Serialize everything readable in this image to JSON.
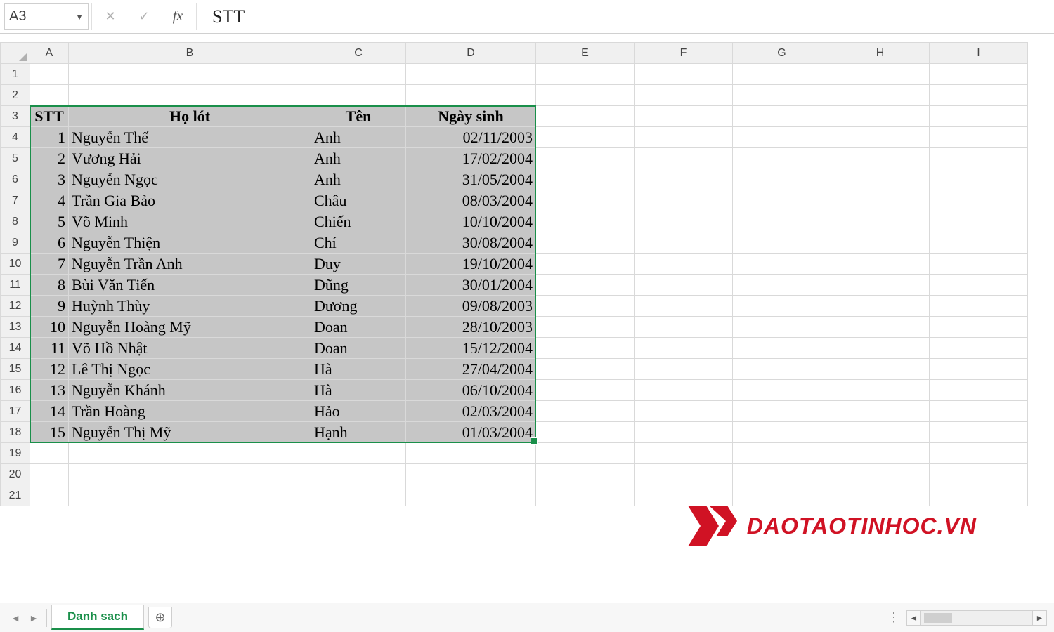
{
  "formula_bar": {
    "cell_ref": "A3",
    "fx_label": "fx",
    "value": "STT"
  },
  "columns": [
    "A",
    "B",
    "C",
    "D",
    "E",
    "F",
    "G",
    "H",
    "I"
  ],
  "row_numbers": [
    1,
    2,
    3,
    4,
    5,
    6,
    7,
    8,
    9,
    10,
    11,
    12,
    13,
    14,
    15,
    16,
    17,
    18,
    19,
    20,
    21
  ],
  "headers": {
    "stt": "STT",
    "ho_lot": "Họ lót",
    "ten": "Tên",
    "ngay_sinh": "Ngày sinh"
  },
  "data": [
    {
      "stt": 1,
      "ho": "Nguyễn Thế",
      "ten": "Anh",
      "dob": "02/11/2003"
    },
    {
      "stt": 2,
      "ho": "Vương Hải",
      "ten": "Anh",
      "dob": "17/02/2004"
    },
    {
      "stt": 3,
      "ho": "Nguyễn Ngọc",
      "ten": "Anh",
      "dob": "31/05/2004"
    },
    {
      "stt": 4,
      "ho": "Trần Gia Bảo",
      "ten": "Châu",
      "dob": "08/03/2004"
    },
    {
      "stt": 5,
      "ho": "Võ Minh",
      "ten": "Chiến",
      "dob": "10/10/2004"
    },
    {
      "stt": 6,
      "ho": "Nguyễn Thiện",
      "ten": "Chí",
      "dob": "30/08/2004"
    },
    {
      "stt": 7,
      "ho": "Nguyễn Trần Anh",
      "ten": "Duy",
      "dob": "19/10/2004"
    },
    {
      "stt": 8,
      "ho": "Bùi Văn Tiến",
      "ten": "Dũng",
      "dob": "30/01/2004"
    },
    {
      "stt": 9,
      "ho": "Huỳnh Thùy",
      "ten": "Dương",
      "dob": "09/08/2003"
    },
    {
      "stt": 10,
      "ho": "Nguyễn Hoàng Mỹ",
      "ten": "Đoan",
      "dob": "28/10/2003"
    },
    {
      "stt": 11,
      "ho": "Võ Hồ Nhật",
      "ten": "Đoan",
      "dob": "15/12/2004"
    },
    {
      "stt": 12,
      "ho": "Lê Thị Ngọc",
      "ten": "Hà",
      "dob": "27/04/2004"
    },
    {
      "stt": 13,
      "ho": "Nguyễn Khánh",
      "ten": "Hà",
      "dob": "06/10/2004"
    },
    {
      "stt": 14,
      "ho": "Trần Hoàng",
      "ten": "Hảo",
      "dob": "02/03/2004"
    },
    {
      "stt": 15,
      "ho": "Nguyễn Thị Mỹ",
      "ten": "Hạnh",
      "dob": "01/03/2004"
    }
  ],
  "sheet_tab": "Danh sach",
  "watermark": "DAOTAOTINHOC.VN",
  "accent_green": "#1a8f4a",
  "accent_red": "#d01224",
  "selection_fill": "#c6c6c6"
}
